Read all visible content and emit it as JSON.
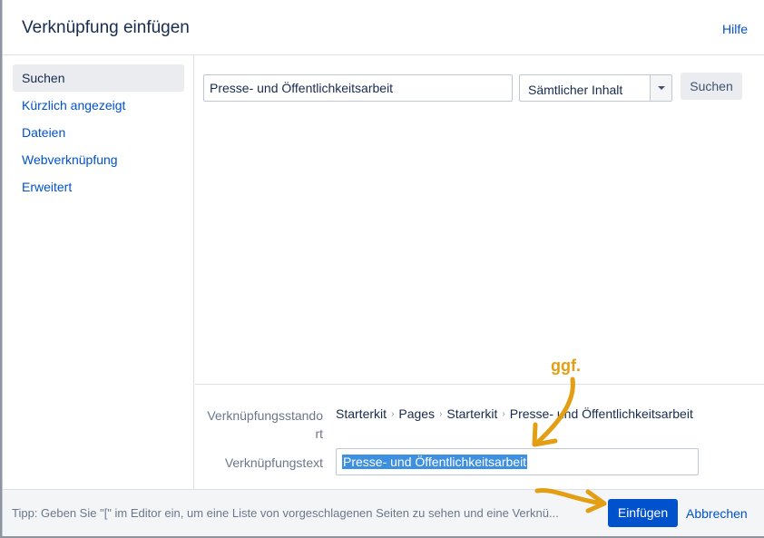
{
  "dialog": {
    "title": "Verknüpfung einfügen",
    "help_label": "Hilfe"
  },
  "sidebar": {
    "items": [
      {
        "label": "Suchen",
        "active": true
      },
      {
        "label": "Kürzlich angezeigt",
        "active": false
      },
      {
        "label": "Dateien",
        "active": false
      },
      {
        "label": "Webverknüpfung",
        "active": false
      },
      {
        "label": "Erweitert",
        "active": false
      }
    ]
  },
  "search": {
    "value": "Presse- und Öffentlichkeitsarbeit",
    "scope_selected": "Sämtlicher Inhalt",
    "button_label": "Suchen"
  },
  "link": {
    "location_label": "Verknüpfungsstandort",
    "location_label_line1": "Verknüpfungsstando",
    "location_label_line2": "rt",
    "breadcrumb": [
      "Starterkit",
      "Pages",
      "Starterkit",
      "Presse- und Öffentlichkeitsarbeit"
    ],
    "text_label": "Verknüpfungstext",
    "text_value": "Presse- und Öffentlichkeitsarbeit"
  },
  "footer": {
    "tip": "Tipp: Geben Sie \"[\" im Editor ein, um eine Liste von vorgeschlagenen Seiten zu sehen und eine Verknü...",
    "insert_label": "Einfügen",
    "cancel_label": "Abbrechen"
  },
  "annotation": {
    "text": "ggf.",
    "color": "#e39e13"
  },
  "colors": {
    "link": "#0052cc",
    "primary_button": "#0052cc",
    "selection": "#3d8fe0"
  }
}
